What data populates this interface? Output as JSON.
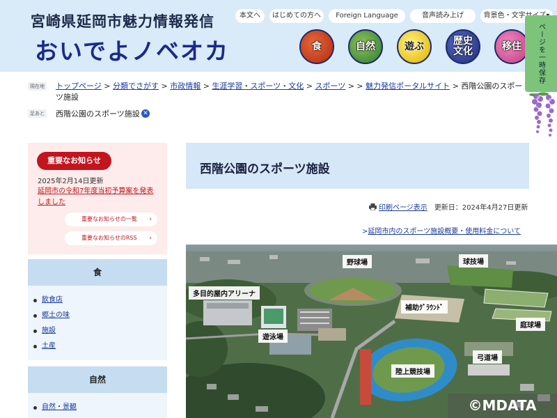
{
  "header": {
    "site_subtitle": "宮崎県延岡市魅力情報発信",
    "site_title": "おいでよノベオカ",
    "util_nav": [
      "本文へ",
      "はじめての方へ",
      "Foreign Language",
      "音声読み上げ",
      "背景色・文字サイズ▾"
    ],
    "categories": [
      {
        "label": "食",
        "icon": "food-icon"
      },
      {
        "label": "自然",
        "icon": "nature-icon"
      },
      {
        "label": "遊ぶ",
        "icon": "play-icon"
      },
      {
        "label": "歴史\n文化",
        "icon": "history-icon"
      },
      {
        "label": "移住",
        "icon": "migration-icon"
      }
    ],
    "side_tab": "ページを一時保存"
  },
  "breadcrumb": {
    "label_current": "現在地",
    "items": [
      "トップページ",
      "分類でさがす",
      "市政情報",
      "生涯学習・スポーツ・文化",
      "スポーツ",
      "",
      "魅力発信ポータルサイト"
    ],
    "current": "西階公園のスポーツ施設",
    "label_saved": "足あと",
    "saved_item": "西階公園のスポーツ施設"
  },
  "notice": {
    "badge": "重要なお知らせ",
    "date": "2025年2月14日更新",
    "link": "延岡市の令和7年度当初予算案を発表しました",
    "list_button": "重要なお知らせの一覧",
    "rss_button": "重要なお知らせのRSS"
  },
  "sidebar": {
    "sections": [
      {
        "title": "食",
        "items": [
          "飲食店",
          "郷土の味",
          "施設",
          "土産"
        ]
      },
      {
        "title": "自然",
        "items": [
          "自然・景観"
        ]
      }
    ]
  },
  "main": {
    "title": "西階公園のスポーツ施設",
    "print_label": "印刷ページ表示",
    "updated": "更新日：2024年4月27日更新",
    "related_link": "延岡市内のスポーツ施設概要・使用料金について",
    "photo_labels": [
      "野球場",
      "球技場",
      "多目的屋内アリーナ",
      "補助ｸﾞﾗｳﾝﾄﾞ",
      "庭球場",
      "遊泳場",
      "弓道場",
      "陸上競技場"
    ],
    "watermark": "©MDATA"
  }
}
